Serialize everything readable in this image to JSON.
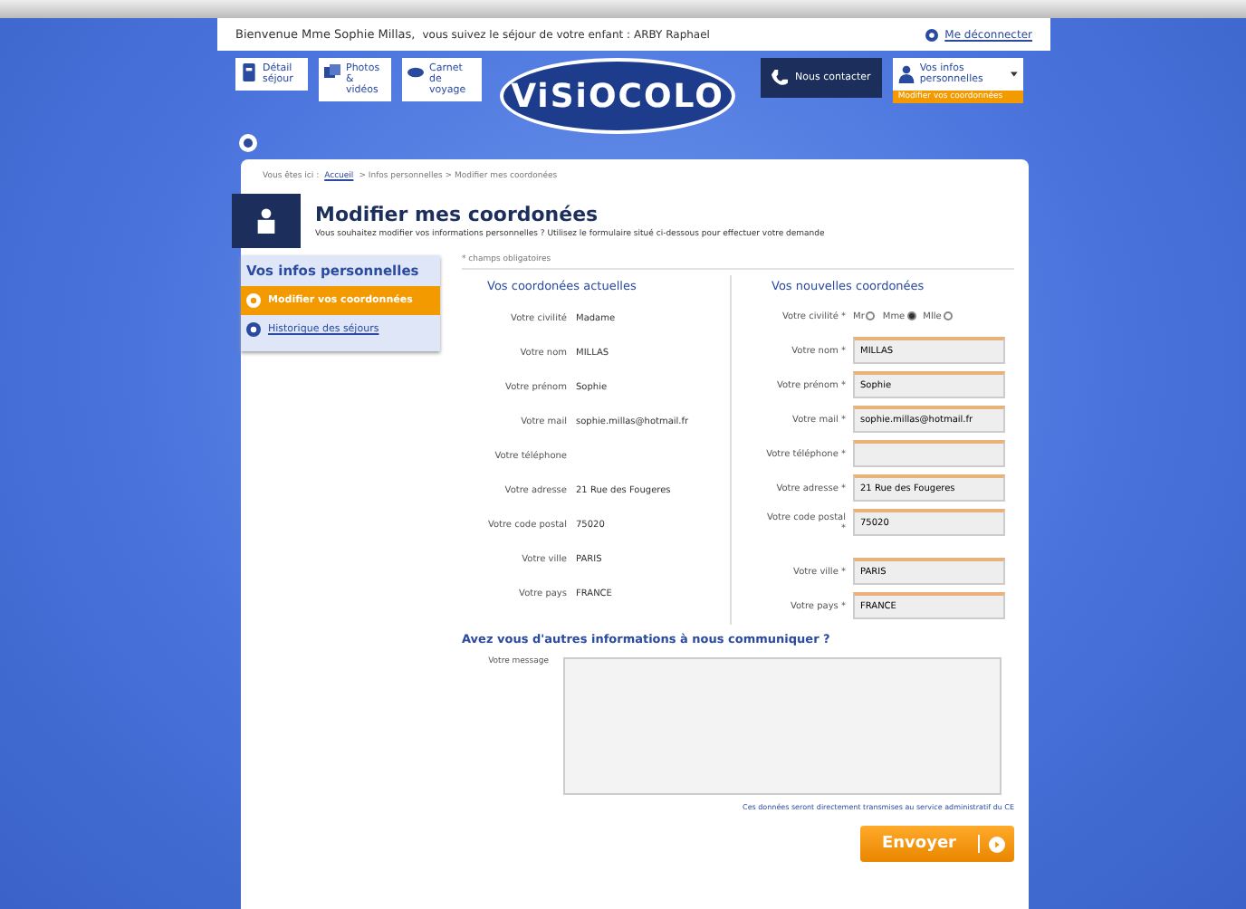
{
  "topbar": {
    "welcome": "Bienvenue Mme Sophie Millas,",
    "stay_text": "vous suivez le séjour de votre enfant : ARBY Raphael",
    "logout": "Me déconnecter"
  },
  "nav": {
    "items": [
      {
        "label": "Détail séjour",
        "kind": "detail"
      },
      {
        "label": "Photos & vidéos",
        "kind": "photo"
      },
      {
        "label": "Carnet de voyage",
        "kind": "carnet"
      }
    ],
    "logo": "ViSiOCOLO",
    "contact": "Nous contacter",
    "account": "Vos infos personnelles",
    "account_sub": "Modifier vos coordonnées"
  },
  "breadcrumb": {
    "prefix": "Vous êtes ici :",
    "links": [
      "Accueil"
    ],
    "rest": "> Infos personnelles > Modifier mes coordonées"
  },
  "header": {
    "title": "Modifier mes coordonées",
    "subtitle": "Vous souhaitez modifier vos informations personnelles ? Utilisez le formulaire situé ci-dessous pour effectuer votre demande"
  },
  "sidebar": {
    "title": "Vos infos personnelles",
    "items": [
      {
        "label": "Modifier vos coordonnées",
        "selected": true
      },
      {
        "label": "Historique des séjours",
        "selected": false
      }
    ]
  },
  "required_note": "* champs obligatoires",
  "current": {
    "title": "Vos coordonées actuelles",
    "rows": [
      {
        "label": "Votre civilité",
        "value": "Madame"
      },
      {
        "label": "Votre nom",
        "value": "MILLAS"
      },
      {
        "label": "Votre prénom",
        "value": "Sophie"
      },
      {
        "label": "Votre mail",
        "value": "sophie.millas@hotmail.fr"
      },
      {
        "label": "Votre téléphone"
      },
      {
        "label": "Votre adresse",
        "value": "21 Rue des Fougeres"
      },
      {
        "label": "Votre code postal",
        "value": "75020"
      },
      {
        "label": "Votre ville",
        "value": "PARIS"
      },
      {
        "label": "Votre pays",
        "value": "FRANCE"
      }
    ]
  },
  "new": {
    "title": "Vos nouvelles coordonées",
    "civility_label": "Votre civilité *",
    "civility": [
      {
        "label": "Mr",
        "selected": false
      },
      {
        "label": "Mme",
        "selected": true
      },
      {
        "label": "Mlle",
        "selected": false
      }
    ],
    "fields": [
      {
        "label": "Votre nom *",
        "value": "MILLAS"
      },
      {
        "label": "Votre prénom *",
        "value": "Sophie"
      },
      {
        "label": "Votre mail *",
        "value": "sophie.millas@hotmail.fr"
      },
      {
        "label": "Votre téléphone *"
      },
      {
        "label": "Votre adresse *",
        "value": "21 Rue des Fougeres"
      },
      {
        "label": "Votre code postal",
        "value": "75020",
        "mark": "*"
      },
      {
        "label": "Votre ville *",
        "value": "PARIS"
      },
      {
        "label": "Votre pays *",
        "value": "FRANCE"
      }
    ]
  },
  "message": {
    "title": "Avez vous d'autres informations à nous communiquer ?",
    "label": "Votre message",
    "note": "Ces données seront directement transmises au service administratif du CE",
    "submit": "Envoyer"
  }
}
